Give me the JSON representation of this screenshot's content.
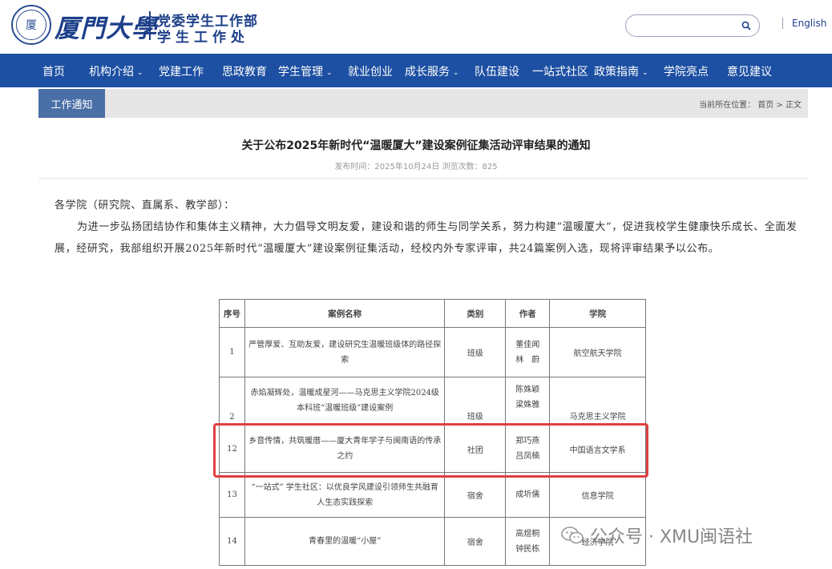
{
  "header": {
    "brand_name": "厦門大學",
    "brand_sub1": "党委学生工作部",
    "brand_sub2": "学生工作处",
    "logo_char": "厦",
    "search_placeholder": "",
    "lang": "English"
  },
  "nav": [
    {
      "label": "首页",
      "caret": ""
    },
    {
      "label": "机构介绍",
      "caret": "⌄"
    },
    {
      "label": "党建工作",
      "caret": ""
    },
    {
      "label": "思政教育",
      "caret": ""
    },
    {
      "label": "学生管理",
      "caret": "⌄"
    },
    {
      "label": "就业创业",
      "caret": ""
    },
    {
      "label": "成长服务",
      "caret": "⌄"
    },
    {
      "label": "队伍建设",
      "caret": ""
    },
    {
      "label": "一站式社区",
      "caret": ""
    },
    {
      "label": "政策指南",
      "caret": "⌄"
    },
    {
      "label": "学院亮点",
      "caret": ""
    },
    {
      "label": "意见建议",
      "caret": ""
    }
  ],
  "subbar": {
    "tab": "工作通知",
    "crumb": "当前所在位置： 首页 > 正文"
  },
  "article": {
    "title": "关于公布2025年新时代“温暖厦大”建设案例征集活动评审结果的通知",
    "meta": "发布时间：2025年10月24日 浏览次数：825",
    "greeting": "各学院（研究院、直属系、教学部）：",
    "body": "为进一步弘扬团结协作和集体主义精神，大力倡导文明友爱，建设和谐的师生与同学关系，努力构建“温暖厦大”，促进我校学生健康快乐成长、全面发展，经研究，我部组织开展2025年新时代“温暖厦大”建设案例征集活动，经校内外专家评审，共24篇案例入选，现将评审结果予以公布。"
  },
  "table": {
    "headers": [
      "序号",
      "案例名称",
      "类别",
      "作者",
      "学院"
    ],
    "rows": [
      {
        "no": "1",
        "name": "严管厚爱、互助友爱，建设研究生温暖班级体的路径探索",
        "cat": "班级",
        "author": "董佳闻\n林　蔚",
        "college": "航空航天学院"
      },
      {
        "no": "2",
        "name": "赤焰凝辉处，温暖成星河——马克思主义学院2024级本科班“温暖班级”建设案例",
        "cat": "班级",
        "author": "陈姝颖\n梁姝雅",
        "college": "马克思主义学院"
      },
      {
        "no": "12",
        "name": "乡音传情，共筑暖厝——厦大青年学子与闽南语的传承之约",
        "cat": "社团",
        "author": "郑巧燕\n吕凤楠",
        "college": "中国语言文学系"
      },
      {
        "no": "13",
        "name": "“一站式” 学生社区：以优良学风建设引领师生共融育人生态实践探索",
        "cat": "宿舍",
        "author": "成圻儒",
        "college": "信息学院"
      },
      {
        "no": "14",
        "name": "青春里的温暖“小屋”",
        "cat": "宿舍",
        "author": "高煜桐\n钟民栋",
        "college": "经济学院"
      }
    ]
  },
  "watermark": {
    "text": "公众号 · XMU闽语社"
  },
  "colors": {
    "brand": "#1d3f8a",
    "nav_bg": "#1d50a2",
    "highlight": "#e04040"
  }
}
